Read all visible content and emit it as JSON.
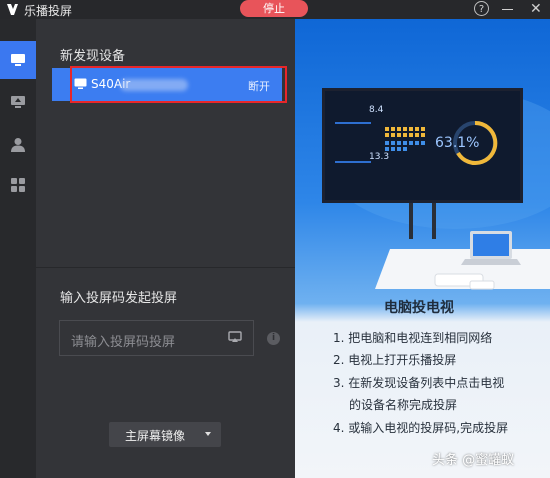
{
  "titlebar": {
    "app_name": "乐播投屏",
    "stop_label": "停止",
    "help_label": "?"
  },
  "sidebar": {
    "items": [
      {
        "icon": "monitor-icon",
        "active": true
      },
      {
        "icon": "screen-upload-icon",
        "active": false
      },
      {
        "icon": "user-icon",
        "active": false
      },
      {
        "icon": "apps-grid-icon",
        "active": false
      }
    ]
  },
  "devices": {
    "section_title": "新发现设备",
    "list": [
      {
        "name": "S40Air",
        "action_label": "断开"
      }
    ]
  },
  "code_cast": {
    "section_title": "输入投屏码发起投屏",
    "placeholder": "请输入投屏码投屏"
  },
  "mirror": {
    "label": "主屏幕镜像"
  },
  "promo": {
    "tv_stats": {
      "value1": "8.4",
      "value2": "13.3",
      "percent": "63.1%"
    },
    "title": "电脑投电视",
    "steps": [
      "1. 把电脑和电视连到相同网络",
      "2. 电视上打开乐播投屏",
      "3. 在新发现设备列表中点击电视",
      "的设备名称完成投屏",
      "4. 或输入电视的投屏码,完成投屏"
    ]
  },
  "watermark": "头条 @蜜罐蚁",
  "colors": {
    "accent": "#3c7df1",
    "stop": "#e8545a",
    "highlight": "#e8262a"
  }
}
